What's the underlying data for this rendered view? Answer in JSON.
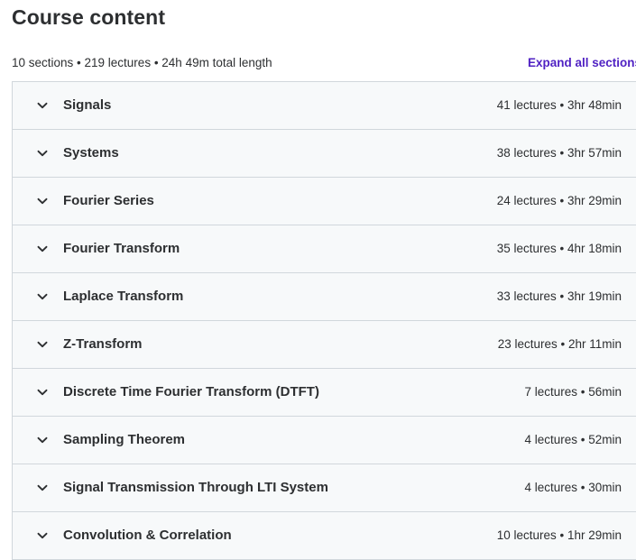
{
  "header": {
    "title": "Course content",
    "summary": "10 sections • 219 lectures • 24h 49m total length",
    "expand_label": "Expand all sections"
  },
  "colors": {
    "accent": "#5022c3",
    "row_background": "#f7f9fa",
    "border": "#d1d7dc",
    "text": "#2d2f31"
  },
  "sections": [
    {
      "title": "Signals",
      "info": "41 lectures • 3hr 48min",
      "icon": "chevron-down-icon"
    },
    {
      "title": "Systems",
      "info": "38 lectures • 3hr 57min",
      "icon": "chevron-down-icon"
    },
    {
      "title": "Fourier Series",
      "info": "24 lectures • 3hr 29min",
      "icon": "chevron-down-icon"
    },
    {
      "title": "Fourier Transform",
      "info": "35 lectures • 4hr 18min",
      "icon": "chevron-down-icon"
    },
    {
      "title": "Laplace Transform",
      "info": "33 lectures • 3hr 19min",
      "icon": "chevron-down-icon"
    },
    {
      "title": "Z-Transform",
      "info": "23 lectures • 2hr 11min",
      "icon": "chevron-down-icon"
    },
    {
      "title": "Discrete Time Fourier Transform (DTFT)",
      "info": "7 lectures • 56min",
      "icon": "chevron-down-icon"
    },
    {
      "title": "Sampling Theorem",
      "info": "4 lectures • 52min",
      "icon": "chevron-down-icon"
    },
    {
      "title": "Signal Transmission Through LTI System",
      "info": "4 lectures • 30min",
      "icon": "chevron-down-icon"
    },
    {
      "title": "Convolution & Correlation",
      "info": "10 lectures • 1hr 29min",
      "icon": "chevron-down-icon"
    }
  ]
}
